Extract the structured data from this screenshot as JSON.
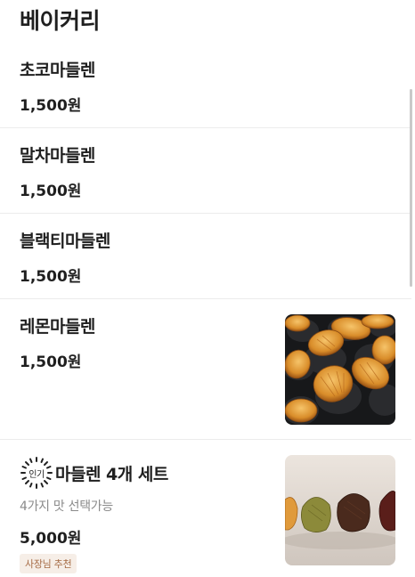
{
  "section": {
    "title": "베이커리"
  },
  "items": [
    {
      "name": "초코마들렌",
      "price": "1,500원"
    },
    {
      "name": "말차마들렌",
      "price": "1,500원"
    },
    {
      "name": "블랙티마들렌",
      "price": "1,500원"
    },
    {
      "name": "레몬마들렌",
      "price": "1,500원",
      "image": "madeleine-tray-photo"
    },
    {
      "popular_label": "인기",
      "name": "마들렌 4개 세트",
      "description": "4가지 맛 선택가능",
      "price": "5,000원",
      "badge": "사장님 추천",
      "image": "madeleine-set-photo"
    }
  ]
}
